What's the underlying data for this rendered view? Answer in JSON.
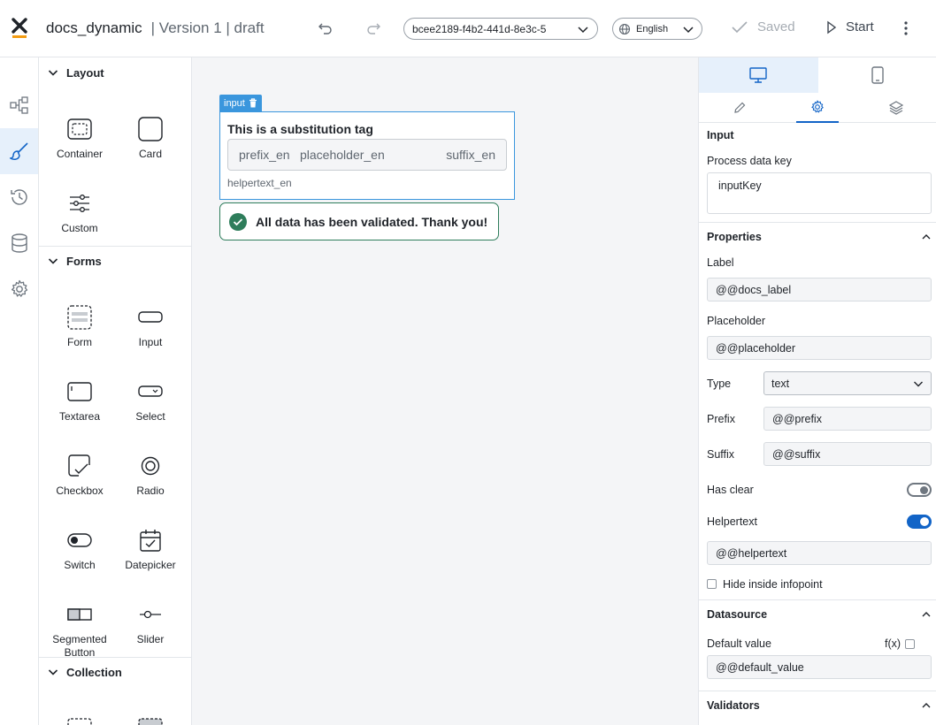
{
  "header": {
    "app_title": "docs_dynamic",
    "version": "| Version 1 | draft",
    "id_select_value": "bcee2189-f4b2-441d-8e3c-5",
    "language": "English",
    "saved_label": "Saved",
    "start_label": "Start"
  },
  "rail": {
    "items": [
      "flow-icon",
      "brush-icon",
      "history-icon",
      "database-icon",
      "gear-icon"
    ],
    "active_index": 1
  },
  "components": {
    "sections": {
      "layout": "Layout",
      "forms": "Forms",
      "collection": "Collection"
    },
    "layout_items": [
      "Container",
      "Card",
      "Custom"
    ],
    "forms_items": [
      "Form",
      "Input",
      "Textarea",
      "Select",
      "Checkbox",
      "Radio",
      "Switch",
      "Datepicker",
      "Segmented Button",
      "Slider"
    ]
  },
  "canvas": {
    "tag_label": "input",
    "input_label": "This is a substitution tag",
    "prefix": "prefix_en",
    "placeholder": "placeholder_en",
    "suffix": "suffix_en",
    "helper": "helpertext_en",
    "success_message": "All data has been validated. Thank you!"
  },
  "props": {
    "section_input": "Input",
    "process_data_key_label": "Process data key",
    "process_data_key_value": "inputKey",
    "section_properties": "Properties",
    "label_label": "Label",
    "label_value": "@@docs_label",
    "placeholder_label": "Placeholder",
    "placeholder_value": "@@placeholder",
    "type_label": "Type",
    "type_value": "text",
    "prefix_label": "Prefix",
    "prefix_value": "@@prefix",
    "suffix_label": "Suffix",
    "suffix_value": "@@suffix",
    "has_clear_label": "Has clear",
    "has_clear": false,
    "helpertext_label": "Helpertext",
    "helpertext_enabled": true,
    "helpertext_value": "@@helpertext",
    "hide_infopoint_label": "Hide inside infopoint",
    "section_datasource": "Datasource",
    "default_value_label": "Default value",
    "fx_label": "f(x)",
    "default_value": "@@default_value",
    "section_validators": "Validators"
  },
  "colors": {
    "accent": "#1264c7",
    "selection": "#3a96dd",
    "success": "#2e7d5b",
    "logo_orange": "#f39c12"
  }
}
